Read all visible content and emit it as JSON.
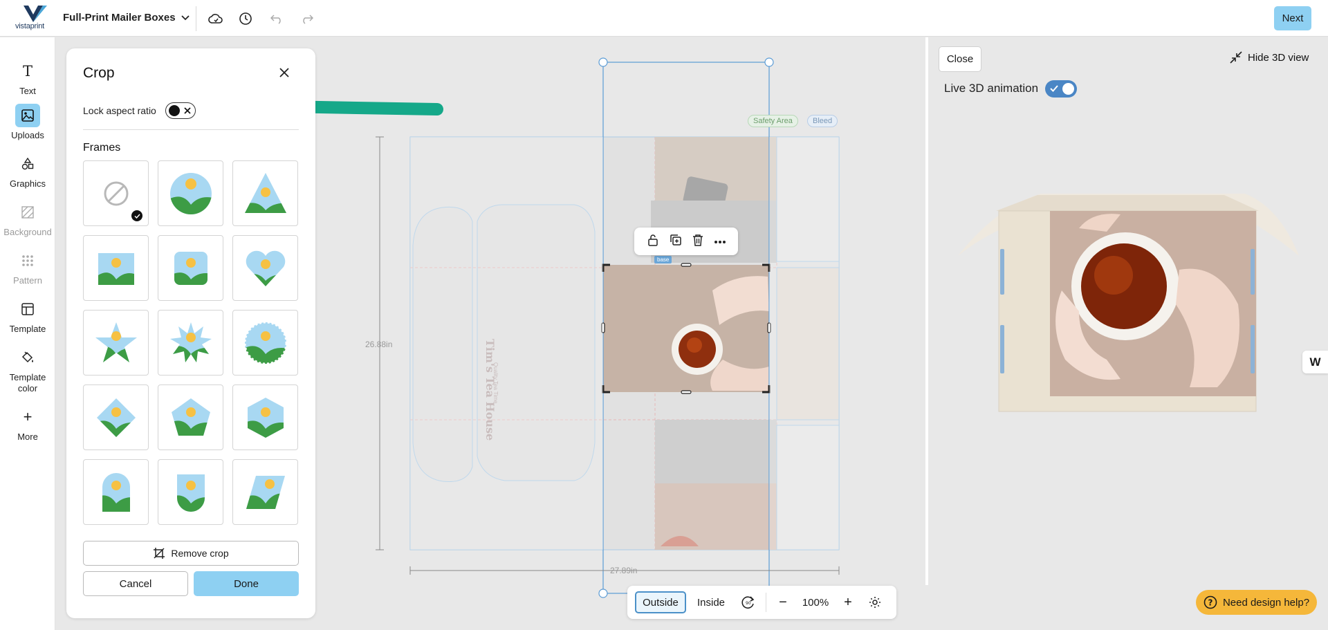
{
  "header": {
    "brand": "vistaprint",
    "product_title": "Full-Print Mailer Boxes",
    "next_label": "Next",
    "icons": [
      "cloud-save-icon",
      "history-icon",
      "undo-icon",
      "redo-icon"
    ]
  },
  "sidebar": {
    "items": [
      {
        "label": "Text",
        "icon": "text-icon"
      },
      {
        "label": "Uploads",
        "icon": "image-upload-icon"
      },
      {
        "label": "Graphics",
        "icon": "shapes-icon"
      },
      {
        "label": "Background",
        "icon": "background-icon"
      },
      {
        "label": "Pattern",
        "icon": "pattern-icon"
      },
      {
        "label": "Template",
        "icon": "template-icon"
      },
      {
        "label": "Template color",
        "icon": "paint-bucket-icon"
      },
      {
        "label": "More",
        "icon": "plus-icon"
      }
    ]
  },
  "crop_panel": {
    "title": "Crop",
    "lock_aspect_label": "Lock aspect ratio",
    "frames_label": "Frames",
    "frames": [
      "none",
      "circle",
      "triangle",
      "square",
      "rounded-square",
      "heart",
      "star",
      "starburst",
      "scalloped-circle",
      "diamond",
      "pentagon",
      "hexagon",
      "arch",
      "shield",
      "parallelogram"
    ],
    "remove_crop_label": "Remove crop",
    "cancel_label": "Cancel",
    "done_label": "Done"
  },
  "canvas": {
    "safety_area_label": "Safety Area",
    "bleed_label": "Bleed",
    "height_label": "26.88in",
    "width_label": "27.89in",
    "image_tag": "base",
    "box_text_title": "Tim's Tea House",
    "box_text_sub": "Quality Tea Time"
  },
  "view_controls": {
    "outside_label": "Outside",
    "inside_label": "Inside",
    "zoom": "100%"
  },
  "preview3d": {
    "close_label": "Close",
    "hide_label": "Hide 3D view",
    "live_label": "Live 3D animation",
    "live_on": true
  },
  "help_label": "Need design help?",
  "colors": {
    "accent": "#8ed0f2",
    "toggle": "#4a86c5",
    "help": "#f5b73a",
    "arrow": "#15a889"
  }
}
